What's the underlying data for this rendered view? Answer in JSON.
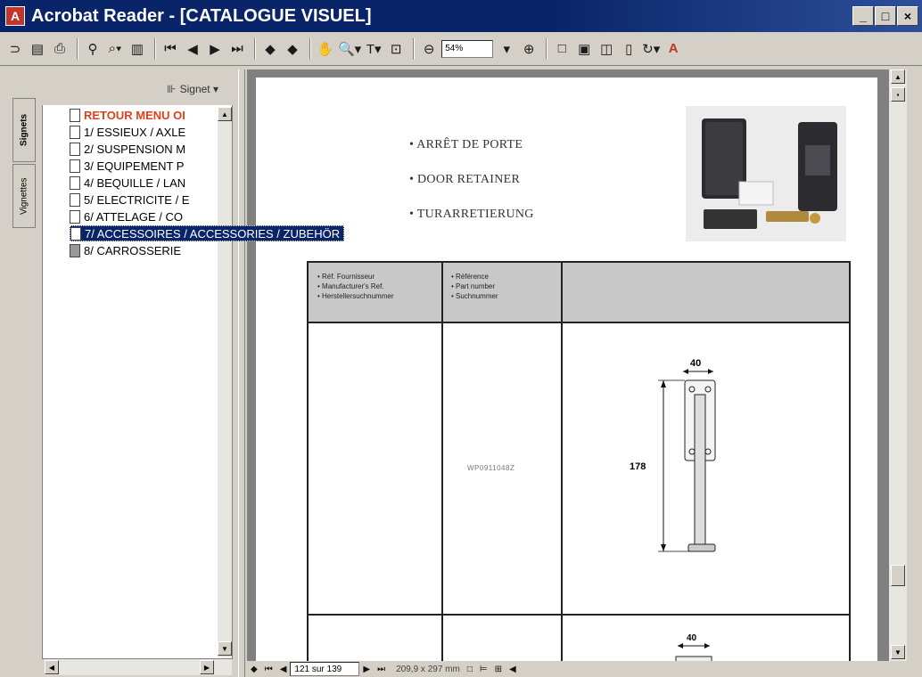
{
  "window": {
    "title": "Acrobat Reader - [CATALOGUE VISUEL]",
    "min": "_",
    "max": "□",
    "close": "×"
  },
  "toolbar": {
    "zoom": "54%"
  },
  "navpane": {
    "header": "Signet ▾",
    "tabs": [
      "Signets",
      "Vignettes"
    ],
    "bookmarks": [
      "RETOUR MENU OI",
      "1/ ESSIEUX / AXLE",
      "2/ SUSPENSION M",
      "3/ EQUIPEMENT P",
      "4/ BEQUILLE / LAN",
      "5/ ELECTRICITE / E",
      "6/ ATTELAGE / CO",
      "7/ ACCESSOIRES / ACCESSORIES / ZUBEHÖR",
      "8/ CARROSSERIE"
    ]
  },
  "page": {
    "lines": [
      "• ARRÊT DE PORTE",
      "• DOOR RETAINER",
      "• TURARRETIERUNG"
    ],
    "table": {
      "col1": [
        "• Réf. Fournisseur",
        "• Manufacturer's Ref.",
        "• Herstellersuchnummer"
      ],
      "col2": [
        "• Référence",
        "• Part number",
        "• Suchnummer"
      ],
      "ref_value": "WP0911048Z",
      "dim_width": "40",
      "dim_height": "178",
      "dim_width2": "40"
    }
  },
  "statusbar": {
    "page": "121 sur 139",
    "size": "209,9 x 297 mm"
  }
}
